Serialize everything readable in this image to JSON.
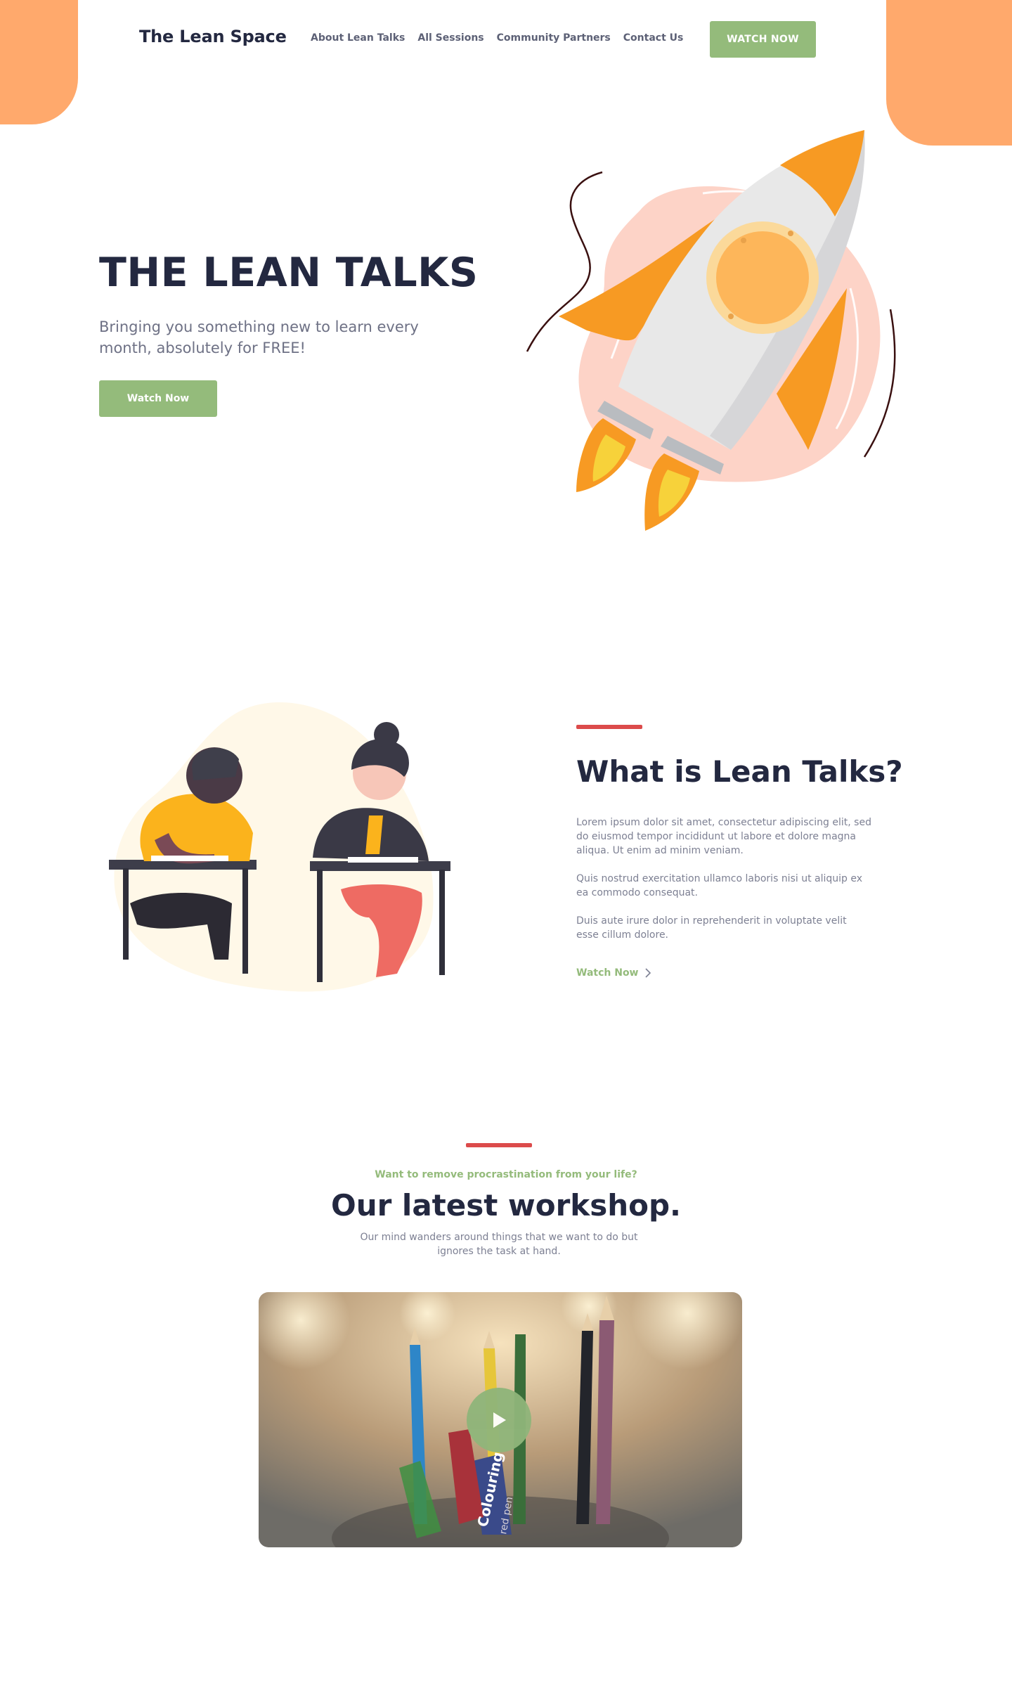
{
  "header": {
    "brand": "The Lean Space",
    "nav": [
      "About Lean Talks",
      "All Sessions",
      "Community Partners",
      "Contact Us"
    ],
    "cta": "WATCH NOW"
  },
  "hero": {
    "title": "THE LEAN TALKS",
    "subtitle": "Bringing you something new to learn every month, absolutely for FREE!",
    "button": "Watch Now"
  },
  "about": {
    "title": "What is Lean Talks?",
    "paragraphs": [
      "Lorem ipsum dolor sit amet, consectetur adipiscing elit, sed do eiusmod tempor incididunt ut labore et dolore magna aliqua. Ut enim ad minim veniam.",
      "Quis nostrud exercitation ullamco laboris nisi ut aliquip ex ea commodo consequat.",
      "Duis aute irure dolor in reprehenderit in voluptate velit esse cillum dolore."
    ],
    "link": "Watch Now"
  },
  "workshop": {
    "kicker": "Want to remove procrastination from your life?",
    "title": "Our latest workshop.",
    "subtitle": "Our mind wanders around things that we want to do but ignores the task at hand.",
    "video_text": [
      "Colouring",
      "red pen"
    ]
  },
  "colors": {
    "accent_green": "#94bb7b",
    "corner_orange": "#ffa96c",
    "heading_navy": "#232840",
    "divider_red": "#dc4b4b",
    "rocket_orange": "#f79a23"
  },
  "icons": {
    "about_link": "chevron-right-icon",
    "video": "play-icon"
  }
}
